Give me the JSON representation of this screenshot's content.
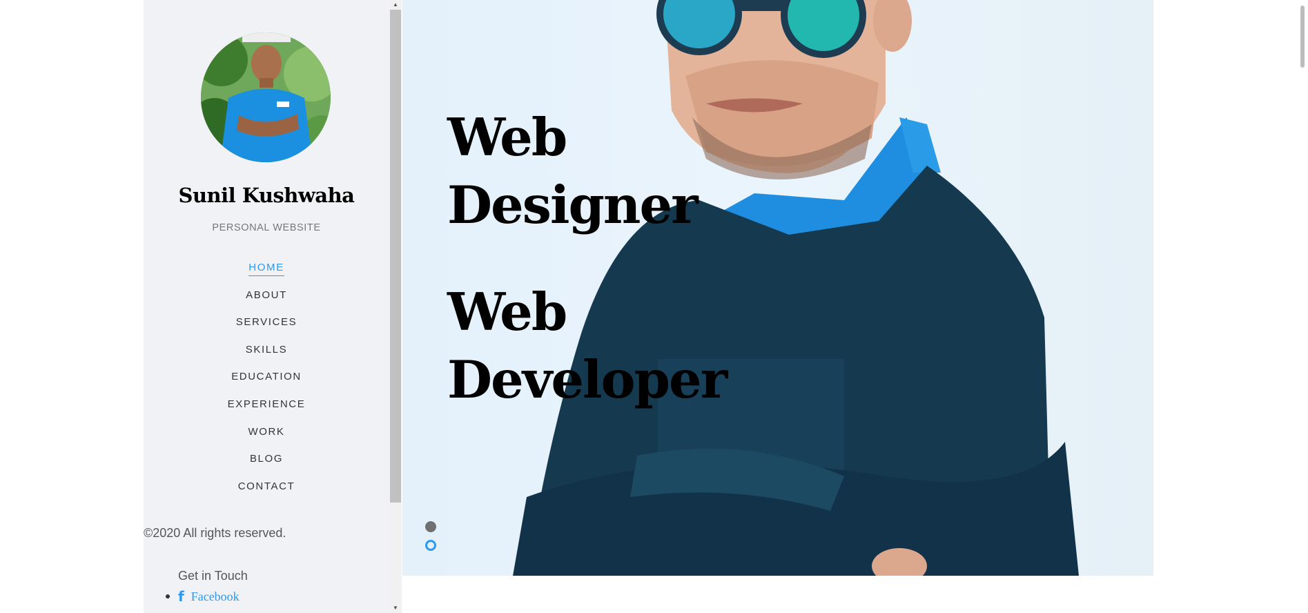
{
  "sidebar": {
    "owner_name": "Sunil Kushwaha",
    "owner_subtitle": "PERSONAL WEBSITE",
    "nav": [
      {
        "label": "HOME",
        "active": true
      },
      {
        "label": "ABOUT",
        "active": false
      },
      {
        "label": "SERVICES",
        "active": false
      },
      {
        "label": "SKILLS",
        "active": false
      },
      {
        "label": "EDUCATION",
        "active": false
      },
      {
        "label": "EXPERIENCE",
        "active": false
      },
      {
        "label": "WORK",
        "active": false
      },
      {
        "label": "BLOG",
        "active": false
      },
      {
        "label": "CONTACT",
        "active": false
      }
    ],
    "copyright": "©2020 All rights reserved.",
    "contact_title": "Get in Touch",
    "social": [
      {
        "icon": "facebook-icon",
        "glyph": "f",
        "label": "Facebook"
      }
    ]
  },
  "hero": {
    "slides": [
      {
        "line1": "Web",
        "line2": "Designer"
      },
      {
        "line1": "Web",
        "line2": "Developer"
      }
    ],
    "active_slide": 0
  },
  "colors": {
    "accent": "#2c98f0",
    "sidebar_bg": "#f1f2f5",
    "text": "#000000"
  }
}
